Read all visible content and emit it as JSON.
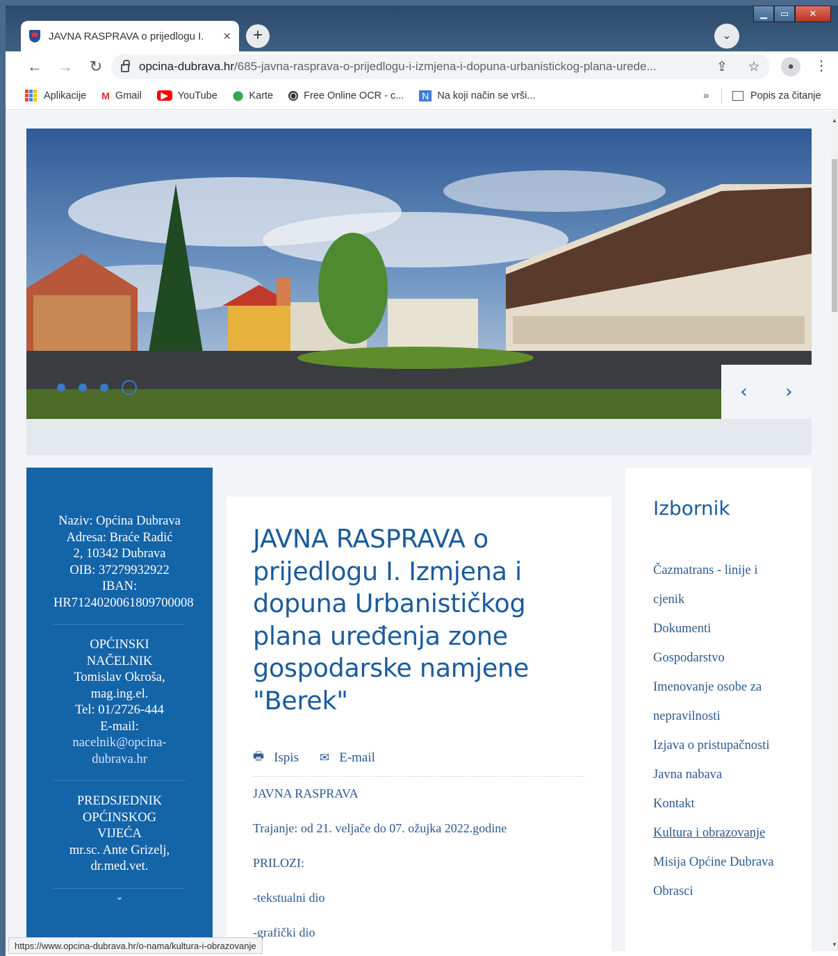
{
  "browser": {
    "tab_title": "JAVNA RASPRAVA o prijedlogu I.",
    "tab_close": "×",
    "new_tab": "+",
    "tab_search": "⌄",
    "url_domain": "opcina-dubrava.hr",
    "url_path": "/685-javna-rasprava-o-prijedlogu-i-izmjena-i-dopuna-urbanistickog-plana-urede...",
    "bookmarks": [
      {
        "label": "Aplikacije",
        "icon": "apps-grid-icon"
      },
      {
        "label": "Gmail",
        "icon": "gmail-icon"
      },
      {
        "label": "YouTube",
        "icon": "youtube-icon"
      },
      {
        "label": "Karte",
        "icon": "maps-icon"
      },
      {
        "label": "Free Online OCR - c...",
        "icon": "ocr-icon"
      },
      {
        "label": "Na koji način se vrši...",
        "icon": "site-icon"
      }
    ],
    "bookmarks_more": "»",
    "reading_list": "Popis za čitanje",
    "status_url": "https://www.opcina-dubrava.hr/o-nama/kultura-i-obrazovanje"
  },
  "slider": {
    "dots": 4,
    "active_dot": 4,
    "prev": "‹",
    "next": "›"
  },
  "info": {
    "block1": [
      "Naziv: Općina Dubrava",
      "Adresa: Braće Radić",
      "2, 10342 Dubrava",
      "OIB: 37279932922",
      "IBAN:",
      "HR7124020061809700008"
    ],
    "block2": [
      "OPĆINSKI",
      "NAČELNIK",
      "Tomislav Okroša,",
      "mag.ing.el.",
      "Tel: 01/2726-444",
      "E-mail:"
    ],
    "email1": "nacelnik@opcina-",
    "email2": "dubrava.hr",
    "block3": [
      "PREDSJEDNIK",
      "OPĆINSKOG",
      "VIJEĆA",
      "mr.sc. Ante Grizelj,",
      "dr.med.vet."
    ],
    "more": "ˇ"
  },
  "article": {
    "title": "JAVNA RASPRAVA o prijedlogu I. Izmjena i dopuna Urbanističkog plana uređenja zone gospodarske namjene \"Berek\"",
    "print_label": "Ispis",
    "email_label": "E-mail",
    "body": [
      "JAVNA RASPRAVA",
      "Trajanje: od 21. veljače do 07. ožujka 2022.godine",
      "PRILOZI:",
      "-tekstualni dio",
      "-grafički dio"
    ]
  },
  "menu": {
    "title": "Izbornik",
    "items": [
      "Čazmatrans - linije i cjenik",
      "Dokumenti",
      "Gospodarstvo",
      "Imenovanje osobe za nepravilnosti",
      "Izjava o pristupačnosti",
      "Javna nabava",
      "Kontakt",
      "Kultura i obrazovanje",
      "Misija Općine Dubrava",
      "Obrasci"
    ],
    "hover_index": 7
  }
}
